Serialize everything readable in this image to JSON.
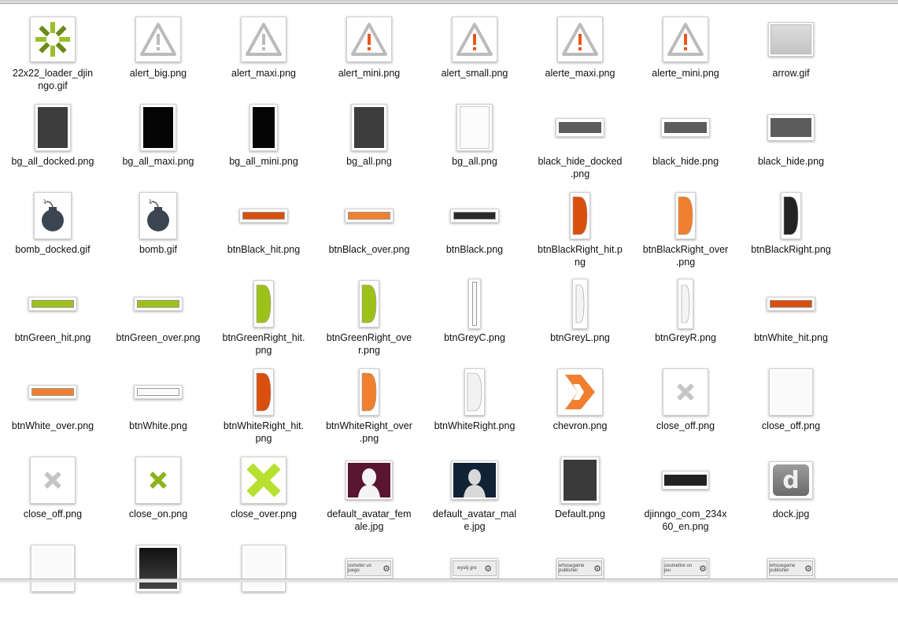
{
  "window": {
    "files": [
      {
        "name": "22x22_loader_djinngo.gif",
        "lines": [
          "22x22_loader_djin",
          "ngo.gif"
        ],
        "thumb": "loader"
      },
      {
        "name": "alert_big.png",
        "lines": [
          "alert_big.png"
        ],
        "thumb": "alert"
      },
      {
        "name": "alert_maxi.png",
        "lines": [
          "alert_maxi.png"
        ],
        "thumb": "alert"
      },
      {
        "name": "alert_mini.png",
        "lines": [
          "alert_mini.png"
        ],
        "thumb": "alert-orange"
      },
      {
        "name": "alert_small.png",
        "lines": [
          "alert_small.png"
        ],
        "thumb": "alert-orange"
      },
      {
        "name": "alerte_maxi.png",
        "lines": [
          "alerte_maxi.png"
        ],
        "thumb": "alert-orange"
      },
      {
        "name": "alerte_mini.png",
        "lines": [
          "alerte_mini.png"
        ],
        "thumb": "alert-orange"
      },
      {
        "name": "arrow.gif",
        "lines": [
          "arrow.gif"
        ],
        "thumb": "arrow"
      },
      {
        "name": "bg_all_docked.png",
        "lines": [
          "bg_all_docked.png"
        ],
        "thumb": "phone-grey"
      },
      {
        "name": "bg_all_maxi.png",
        "lines": [
          "bg_all_maxi.png"
        ],
        "thumb": "phone-black"
      },
      {
        "name": "bg_all_mini.png",
        "lines": [
          "bg_all_mini.png"
        ],
        "thumb": "phone-slim"
      },
      {
        "name": "bg_all.png",
        "lines": [
          "bg_all.png"
        ],
        "thumb": "phone-grey"
      },
      {
        "name": "bg_all.png",
        "lines": [
          "bg_all.png"
        ],
        "thumb": "phone-white"
      },
      {
        "name": "black_hide_docked.png",
        "lines": [
          "black_hide_docked",
          ".png"
        ],
        "thumb": "wide"
      },
      {
        "name": "black_hide.png",
        "lines": [
          "black_hide.png"
        ],
        "thumb": "wide"
      },
      {
        "name": "black_hide.png",
        "lines": [
          "black_hide.png"
        ],
        "thumb": "wide2"
      },
      {
        "name": "bomb_docked.gif",
        "lines": [
          "bomb_docked.gif"
        ],
        "thumb": "bomb"
      },
      {
        "name": "bomb.gif",
        "lines": [
          "bomb.gif"
        ],
        "thumb": "bomb"
      },
      {
        "name": "btnBlack_hit.png",
        "lines": [
          "btnBlack_hit.png"
        ],
        "thumb": "bar-darkorange"
      },
      {
        "name": "btnBlack_over.png",
        "lines": [
          "btnBlack_over.png"
        ],
        "thumb": "bar-orange"
      },
      {
        "name": "btnBlack.png",
        "lines": [
          "btnBlack.png"
        ],
        "thumb": "bar-black"
      },
      {
        "name": "btnBlackRight_hit.png",
        "lines": [
          "btnBlackRight_hit.p",
          "ng"
        ],
        "thumb": "half-darkorange"
      },
      {
        "name": "btnBlackRight_over.png",
        "lines": [
          "btnBlackRight_over",
          ".png"
        ],
        "thumb": "half-orange"
      },
      {
        "name": "btnBlackRight.png",
        "lines": [
          "btnBlackRight.png"
        ],
        "thumb": "half-black"
      },
      {
        "name": "btnGreen_hit.png",
        "lines": [
          "btnGreen_hit.png"
        ],
        "thumb": "bar-green"
      },
      {
        "name": "btnGreen_over.png",
        "lines": [
          "btnGreen_over.png"
        ],
        "thumb": "bar-green"
      },
      {
        "name": "btnGreenRight_hit.png",
        "lines": [
          "btnGreenRight_hit.",
          "png"
        ],
        "thumb": "half-green"
      },
      {
        "name": "btnGreenRight_over.png",
        "lines": [
          "btnGreenRight_ove",
          "r.png"
        ],
        "thumb": "half-green"
      },
      {
        "name": "btnGreyC.png",
        "lines": [
          "btnGreyC.png"
        ],
        "thumb": "slim"
      },
      {
        "name": "btnGreyL.png",
        "lines": [
          "btnGreyL.png"
        ],
        "thumb": "slim-half"
      },
      {
        "name": "btnGreyR.png",
        "lines": [
          "btnGreyR.png"
        ],
        "thumb": "slim-half"
      },
      {
        "name": "btnWhite_hit.png",
        "lines": [
          "btnWhite_hit.png"
        ],
        "thumb": "bar-darkorange"
      },
      {
        "name": "btnWhite_over.png",
        "lines": [
          "btnWhite_over.png"
        ],
        "thumb": "bar-orange"
      },
      {
        "name": "btnWhite.png",
        "lines": [
          "btnWhite.png"
        ],
        "thumb": "bar-white"
      },
      {
        "name": "btnWhiteRight_hit.png",
        "lines": [
          "btnWhiteRight_hit.",
          "png"
        ],
        "thumb": "half-darkorange"
      },
      {
        "name": "btnWhiteRight_over.png",
        "lines": [
          "btnWhiteRight_over",
          ".png"
        ],
        "thumb": "half-orange"
      },
      {
        "name": "btnWhiteRight.png",
        "lines": [
          "btnWhiteRight.png"
        ],
        "thumb": "half-white"
      },
      {
        "name": "chevron.png",
        "lines": [
          "chevron.png"
        ],
        "thumb": "chevron"
      },
      {
        "name": "close_off.png",
        "lines": [
          "close_off.png"
        ],
        "thumb": "close-grey"
      },
      {
        "name": "close_off.png",
        "lines": [
          "close_off.png"
        ],
        "thumb": "blank"
      },
      {
        "name": "close_off.png",
        "lines": [
          "close_off.png"
        ],
        "thumb": "close-grey"
      },
      {
        "name": "close_on.png",
        "lines": [
          "close_on.png"
        ],
        "thumb": "close-green"
      },
      {
        "name": "close_over.png",
        "lines": [
          "close_over.png"
        ],
        "thumb": "close-lime"
      },
      {
        "name": "default_avatar_female.jpg",
        "lines": [
          "default_avatar_fem",
          "ale.jpg"
        ],
        "thumb": "avatar-female"
      },
      {
        "name": "default_avatar_male.jpg",
        "lines": [
          "default_avatar_mal",
          "e.jpg"
        ],
        "thumb": "avatar-male"
      },
      {
        "name": "Default.png",
        "lines": [
          "Default.png"
        ],
        "thumb": "dark"
      },
      {
        "name": "djinngo_com_234x60_en.png",
        "lines": [
          "djinngo_com_234x",
          "60_en.png"
        ],
        "thumb": "banner"
      },
      {
        "name": "dock.jpg",
        "lines": [
          "dock.jpg"
        ],
        "thumb": "dock"
      },
      {
        "name": "",
        "lines": [],
        "thumb": "blank"
      },
      {
        "name": "",
        "lines": [],
        "thumb": "darkgrad"
      },
      {
        "name": "",
        "lines": [],
        "thumb": "blank"
      },
      {
        "name": "",
        "lines": [],
        "thumb": "badge",
        "badge_text": "someter un juego"
      },
      {
        "name": "",
        "lines": [],
        "thumb": "badge",
        "badge_text": "wyslij gre"
      },
      {
        "name": "",
        "lines": [],
        "thumb": "badge",
        "badge_text": "whosegame publisher"
      },
      {
        "name": "",
        "lines": [],
        "thumb": "badge",
        "badge_text": "soumettre un jeu"
      },
      {
        "name": "",
        "lines": [],
        "thumb": "badge",
        "badge_text": "whosegame publisher"
      }
    ],
    "dock_letter": "d",
    "colors": {
      "orange": "#f08030",
      "darkorange": "#d9500e",
      "green": "#9cc21a",
      "lime": "#b8e030",
      "alert_grey": "#bbbbbb",
      "alert_orange": "#e8571c"
    }
  }
}
